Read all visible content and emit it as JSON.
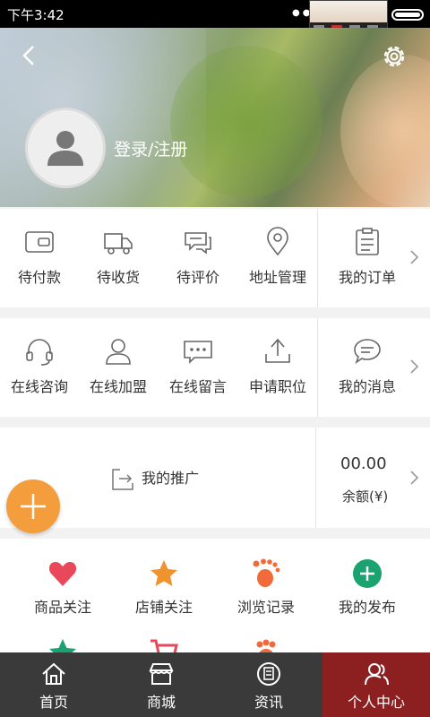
{
  "status_bar": {
    "time": "下午3:42"
  },
  "profile": {
    "login_text": "登录/注册"
  },
  "orders_row": {
    "items": [
      {
        "label": "待付款",
        "icon": "wallet-icon"
      },
      {
        "label": "待收货",
        "icon": "truck-icon"
      },
      {
        "label": "待评价",
        "icon": "comment-icon"
      },
      {
        "label": "地址管理",
        "icon": "location-pin-icon"
      }
    ],
    "side": {
      "label": "我的订单",
      "icon": "order-list-icon"
    }
  },
  "services_row": {
    "items": [
      {
        "label": "在线咨询",
        "icon": "headset-icon"
      },
      {
        "label": "在线加盟",
        "icon": "user-icon"
      },
      {
        "label": "在线留言",
        "icon": "message-dots-icon"
      },
      {
        "label": "申请职位",
        "icon": "upload-icon"
      }
    ],
    "side": {
      "label": "我的消息",
      "icon": "chat-bubble-icon"
    }
  },
  "promo": {
    "label": "我的推广",
    "icon": "share-arrow-icon"
  },
  "balance": {
    "value": "00.00",
    "label": "余额(¥)"
  },
  "grid": [
    {
      "label": "商品关注",
      "icon": "heart-icon",
      "color": "#e8485a"
    },
    {
      "label": "店铺关注",
      "icon": "star-icon",
      "color": "#f0922e"
    },
    {
      "label": "浏览记录",
      "icon": "footprint-icon",
      "color": "#f06a3a"
    },
    {
      "label": "我的发布",
      "icon": "plus-circle-icon",
      "color": "#1aa36e"
    }
  ],
  "grid_row2_icons": [
    "star-icon",
    "cart-icon",
    "footprint-icon"
  ],
  "colors": {
    "accent": "#f39d3c",
    "nav_bg": "#3a3a3a",
    "nav_active": "#8c2020"
  },
  "nav": [
    {
      "label": "首页",
      "icon": "home-icon"
    },
    {
      "label": "商城",
      "icon": "store-icon"
    },
    {
      "label": "资讯",
      "icon": "news-icon"
    },
    {
      "label": "个人中心",
      "icon": "person-icon"
    }
  ]
}
